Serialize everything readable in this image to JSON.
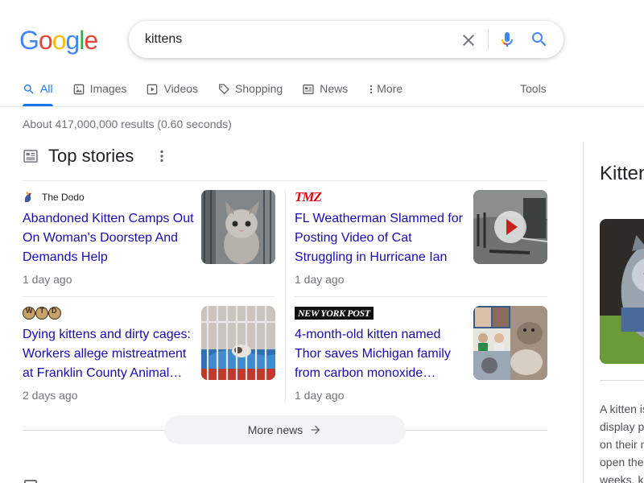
{
  "logo": {
    "text": "Google",
    "letters": [
      {
        "ch": "G",
        "color": "#4285F4"
      },
      {
        "ch": "o",
        "color": "#EA4335"
      },
      {
        "ch": "o",
        "color": "#FBBC05"
      },
      {
        "ch": "g",
        "color": "#4285F4"
      },
      {
        "ch": "l",
        "color": "#34A853"
      },
      {
        "ch": "e",
        "color": "#EA4335"
      }
    ]
  },
  "search": {
    "query": "kittens",
    "clear_icon": "close-icon",
    "voice_icon": "mic-icon",
    "submit_icon": "search-icon"
  },
  "tabs": [
    {
      "label": "All",
      "icon": "search-icon",
      "active": true
    },
    {
      "label": "Images",
      "icon": "image-icon",
      "active": false
    },
    {
      "label": "Videos",
      "icon": "video-icon",
      "active": false
    },
    {
      "label": "Shopping",
      "icon": "tag-icon",
      "active": false
    },
    {
      "label": "News",
      "icon": "news-icon",
      "active": false
    },
    {
      "label": "More",
      "icon": "kebab-icon",
      "active": false
    }
  ],
  "tools_label": "Tools",
  "result_stats": "About 417,000,000 results (0.60 seconds)",
  "top_stories": {
    "title": "Top stories",
    "stories": [
      {
        "source": "The Dodo",
        "headline": "Abandoned Kitten Camps Out On Woman's Doorstep And Demands Help",
        "age": "1 day ago",
        "thumb": "kitten-photo"
      },
      {
        "source": "TMZ",
        "headline": "FL Weatherman Slammed for Posting Video of Cat Struggling in Hurricane Ian",
        "age": "1 day ago",
        "thumb": "flood-video"
      },
      {
        "source": "WTD",
        "headline": "Dying kittens and dirty cages: Workers allege mistreatment at Franklin County Animal…",
        "age": "2 days ago",
        "thumb": "cage-photo"
      },
      {
        "source": "NEW YORK POST",
        "headline": "4-month-old kitten named Thor saves Michigan family from carbon monoxide…",
        "age": "1 day ago",
        "thumb": "family-collage"
      }
    ],
    "more_label": "More news"
  },
  "knowledge_panel": {
    "title": "Kitten",
    "description_lines": [
      "A kitten is",
      "display p",
      "on their n",
      "open the",
      "weeks, k"
    ]
  },
  "colors": {
    "link": "#1a0dab",
    "accent": "#1a73e8",
    "muted": "#70757a"
  }
}
